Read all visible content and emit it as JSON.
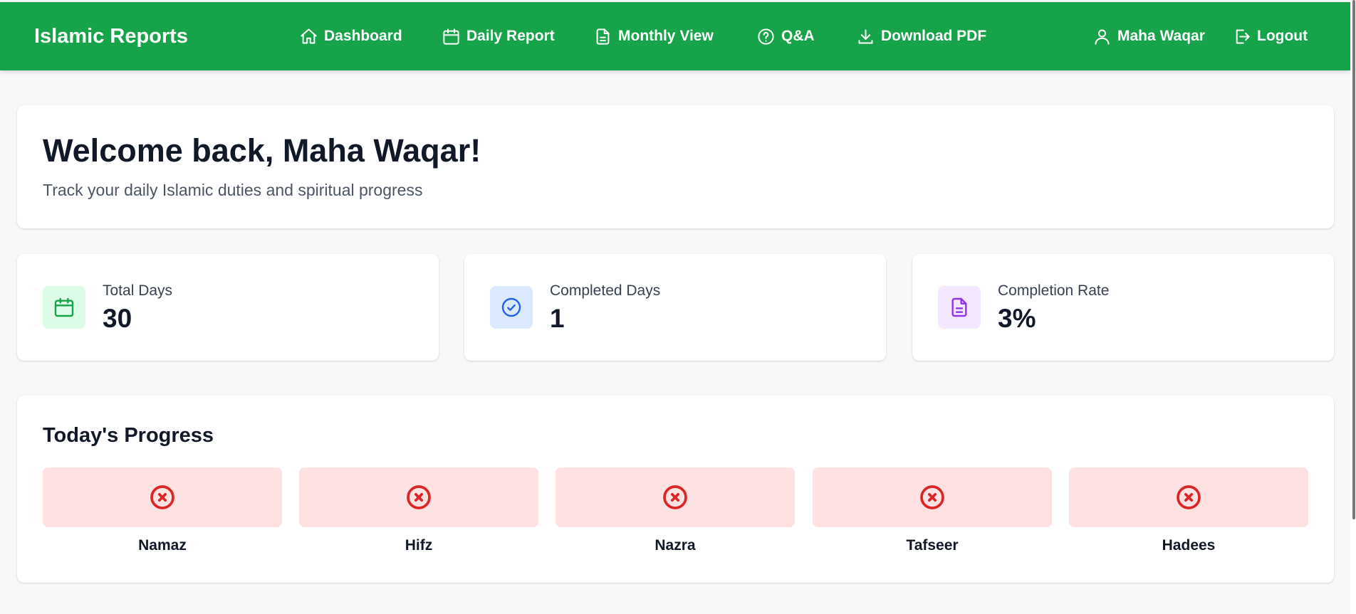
{
  "app": {
    "brand": "Islamic Reports"
  },
  "nav": {
    "dashboard": "Dashboard",
    "daily_report": "Daily Report",
    "monthly_view": "Monthly View",
    "qa": "Q&A",
    "download_pdf": "Download PDF",
    "user_name": "Maha Waqar",
    "logout": "Logout"
  },
  "welcome": {
    "title": "Welcome back, Maha Waqar!",
    "subtitle": "Track your daily Islamic duties and spiritual progress"
  },
  "stats": [
    {
      "label": "Total Days",
      "value": "30",
      "icon": "calendar-icon",
      "icon_color": "#16a34a",
      "bg": "#dcfce7"
    },
    {
      "label": "Completed Days",
      "value": "1",
      "icon": "check-circle-icon",
      "icon_color": "#2563eb",
      "bg": "#dbeafe"
    },
    {
      "label": "Completion Rate",
      "value": "3%",
      "icon": "document-icon",
      "icon_color": "#9333ea",
      "bg": "#f3e8ff"
    }
  ],
  "progress": {
    "title": "Today's Progress",
    "items": [
      {
        "label": "Namaz",
        "status": "incomplete"
      },
      {
        "label": "Hifz",
        "status": "incomplete"
      },
      {
        "label": "Nazra",
        "status": "incomplete"
      },
      {
        "label": "Tafseer",
        "status": "incomplete"
      },
      {
        "label": "Hadees",
        "status": "incomplete"
      }
    ]
  },
  "colors": {
    "navbar": "#16a34a",
    "incomplete_bg": "#fee2e2",
    "incomplete_icon": "#dc2626"
  }
}
